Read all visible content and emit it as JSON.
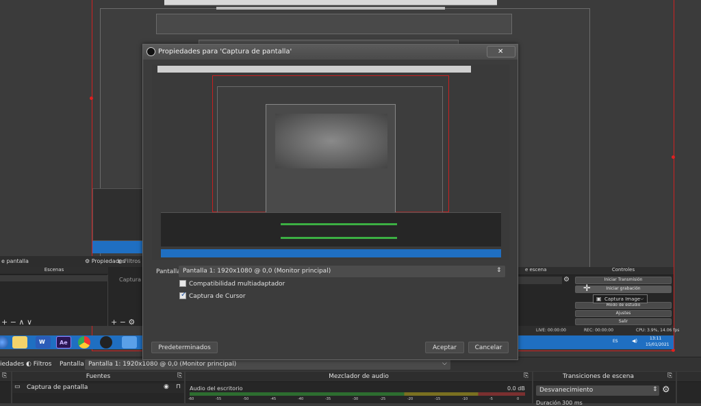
{
  "dialog": {
    "title": "Propiedades para 'Captura de pantalla'",
    "close_glyph": "✕",
    "field_label": "Pantalla",
    "field_value": "Pantalla 1: 1920x1080 @ 0,0 (Monitor principal)",
    "checkbox_multiadapter": {
      "label": "Compatibilidad multiadaptador",
      "checked": false
    },
    "checkbox_cursor": {
      "label": "Captura de Cursor",
      "checked": true
    },
    "defaults_button": "Predeterminados",
    "accept_button": "Aceptar",
    "cancel_button": "Cancelar"
  },
  "bg_left": {
    "captura_label": "e pantalla",
    "propiedades": "Propiedades",
    "filtros_small": "Filtros",
    "escenas": "Escenas",
    "captura_de_small": "Captura de p",
    "ctrl_glyphs": "+ − ∧ ∨"
  },
  "bg_right": {
    "transiciones_frag": "e escena",
    "controles": "Controles",
    "iniciar_transmision": "Iniciar Transmisión",
    "iniciar_grabacion": "Iniciar grabación",
    "captura_image": "Captura Image",
    "modo_estudio": "Modo de estudio",
    "ajustes": "Ajustes",
    "salir": "Salir",
    "live": "LIVE: 00:00:00",
    "rec": "REC: 00:00:00",
    "cpu": "CPU: 3.9%, 14.06 fps",
    "lang": "ES",
    "time": "13:11",
    "date": "15/01/2021"
  },
  "main_bottom": {
    "propiedades_frag": "iedades",
    "filtros": "Filtros",
    "pantalla": "Pantalla",
    "pantalla_value": "Pantalla 1: 1920x1080 @ 0,0 (Monitor principal)",
    "fuentes": "Fuentes",
    "source_item": "Captura de pantalla",
    "mezclador": "Mezclador de audio",
    "audio_source": "Audio del escritorio",
    "audio_level": "0.0 dB",
    "transiciones": "Transiciones de escena",
    "transition_value": "Desvanecimiento",
    "duracion_label": "Duración",
    "duracion_value": "300 ms",
    "ticks": [
      "-60",
      "-55",
      "-50",
      "-45",
      "-40",
      "-35",
      "-30",
      "-25",
      "-20",
      "-15",
      "-10",
      "-5",
      "0"
    ]
  },
  "icons": [
    "obs-logo-icon",
    "close-icon",
    "chevron-updown-icon",
    "gear-icon",
    "eye-icon",
    "lock-icon",
    "monitor-icon",
    "filter-icon",
    "speaker-icon",
    "camera-icon"
  ],
  "colors": {
    "accent_red": "#d12020",
    "taskbar_blue": "#1f6fc2",
    "meter_green": "#3cb043",
    "meter_yellow": "#c8b400",
    "meter_red": "#c83232"
  }
}
